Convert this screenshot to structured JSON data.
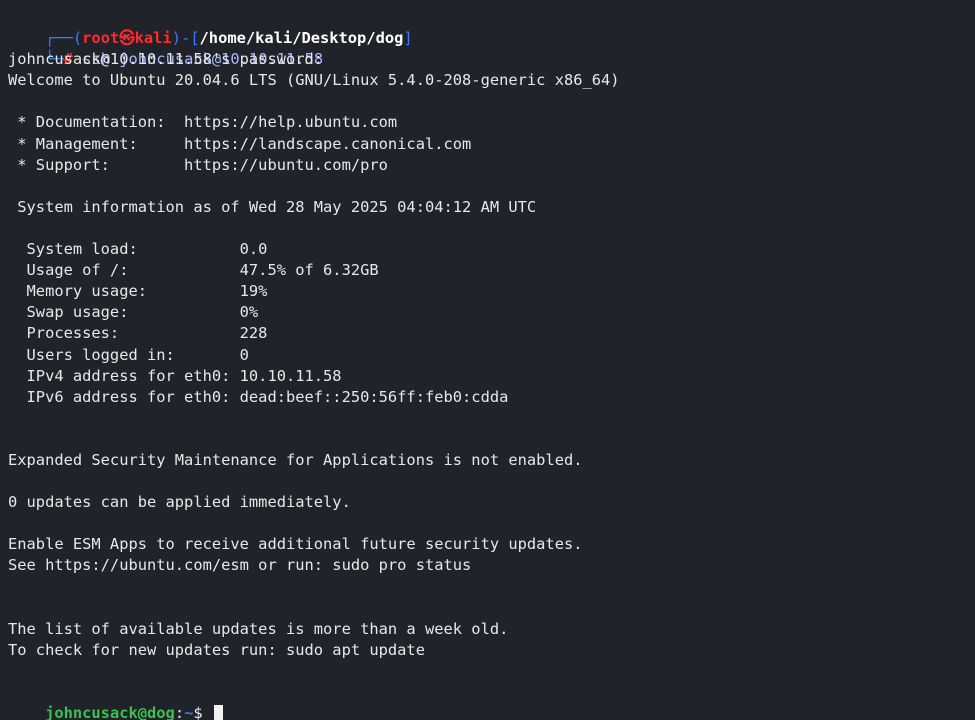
{
  "prompt": {
    "box_top": "┌──(",
    "user": "root",
    "at_symbol": "㉿",
    "host": "kali",
    "sep": ")-[",
    "path": "/home/kali/Desktop/dog",
    "close": "]",
    "box_bottom": "└─",
    "hash": "#",
    "command": " ssh johncusack@10.10.11.58"
  },
  "output_lines": [
    "johncusack@10.10.11.58's password:",
    "Welcome to Ubuntu 20.04.6 LTS (GNU/Linux 5.4.0-208-generic x86_64)",
    "",
    " * Documentation:  https://help.ubuntu.com",
    " * Management:     https://landscape.canonical.com",
    " * Support:        https://ubuntu.com/pro",
    "",
    " System information as of Wed 28 May 2025 04:04:12 AM UTC",
    "",
    "  System load:           0.0",
    "  Usage of /:            47.5% of 6.32GB",
    "  Memory usage:          19%",
    "  Swap usage:            0%",
    "  Processes:             228",
    "  Users logged in:       0",
    "  IPv4 address for eth0: 10.10.11.58",
    "  IPv6 address for eth0: dead:beef::250:56ff:feb0:cdda",
    "",
    "",
    "Expanded Security Maintenance for Applications is not enabled.",
    "",
    "0 updates can be applied immediately.",
    "",
    "Enable ESM Apps to receive additional future security updates.",
    "See https://ubuntu.com/esm or run: sudo pro status",
    "",
    "",
    "The list of available updates is more than a week old.",
    "To check for new updates run: sudo apt update",
    ""
  ],
  "remote_prompt": {
    "user_host": "johncusack@dog",
    "colon": ":",
    "path": "~",
    "dollar": "$ "
  }
}
